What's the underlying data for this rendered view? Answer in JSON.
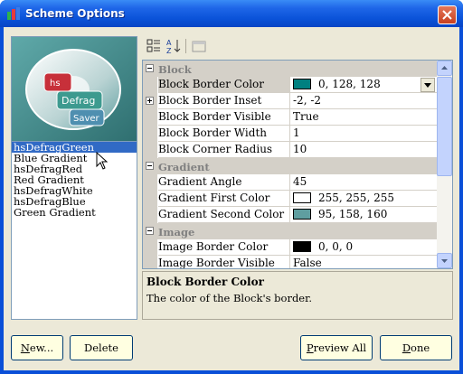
{
  "window": {
    "title": "Scheme Options"
  },
  "preview": {
    "labels": [
      "hs",
      "Defrag",
      "Saver"
    ]
  },
  "schemes": {
    "items": [
      "hsDefragGreen",
      "Blue Gradient",
      "hsDefragRed",
      "Red Gradient",
      "hsDefragWhite",
      "hsDefragBlue",
      "Green Gradient"
    ],
    "selected_index": 0
  },
  "toolbar": {
    "buttons": [
      "categorized-icon",
      "alphabetical-icon",
      "property-pages-icon"
    ]
  },
  "properties": {
    "categories": {
      "block": "Block",
      "gradient": "Gradient",
      "image": "Image"
    },
    "rows": {
      "block_border_color": {
        "name": "Block Border Color",
        "value": "0, 128, 128",
        "swatch": "#008080"
      },
      "block_border_inset": {
        "name": "Block Border Inset",
        "value": "-2, -2"
      },
      "block_border_visible": {
        "name": "Block Border Visible",
        "value": "True"
      },
      "block_border_width": {
        "name": "Block Border Width",
        "value": "1"
      },
      "block_corner_radius": {
        "name": "Block Corner Radius",
        "value": "10"
      },
      "gradient_angle": {
        "name": "Gradient Angle",
        "value": "45"
      },
      "gradient_first_color": {
        "name": "Gradient First Color",
        "value": "255, 255, 255",
        "swatch": "#ffffff"
      },
      "gradient_second_color": {
        "name": "Gradient Second Color",
        "value": "95, 158, 160",
        "swatch": "#5f9ea0"
      },
      "image_border_color": {
        "name": "Image Border Color",
        "value": "0, 0, 0",
        "swatch": "#000000"
      },
      "image_border_visible": {
        "name": "Image Border Visible",
        "value": "False"
      }
    }
  },
  "help": {
    "title": "Block Border Color",
    "description": "The color of the Block's border."
  },
  "buttons": {
    "new": {
      "accel": "N",
      "rest": "ew..."
    },
    "delete": {
      "label": "Delete"
    },
    "preview_all": {
      "accel": "P",
      "rest": "review All"
    },
    "done": {
      "accel": "D",
      "rest": "one"
    }
  },
  "colors": {
    "titlebar": "#0a52d8",
    "dialog_bg": "#ece9d8",
    "selection": "#316ac5",
    "button_bg": "#ffffe1",
    "grid_line": "#d4d0c8"
  }
}
